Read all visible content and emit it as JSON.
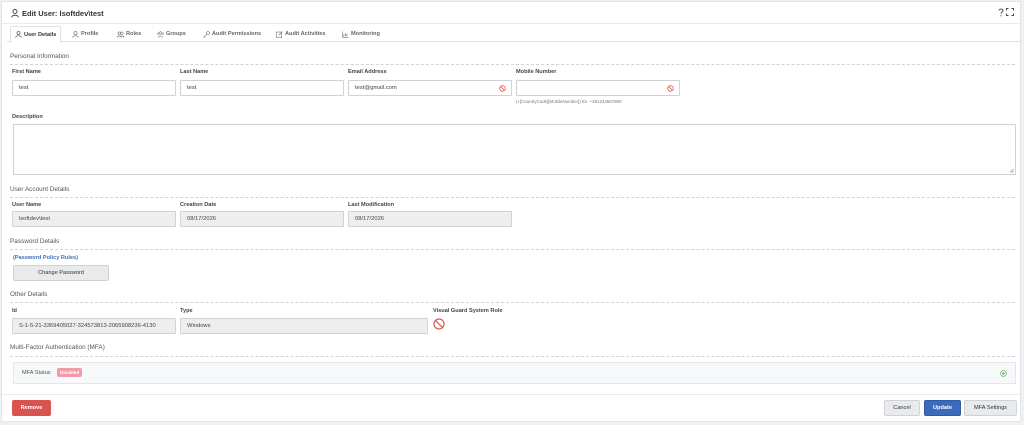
{
  "window": {
    "title": "Edit User: lsoftdev\\test"
  },
  "tabs": [
    {
      "label": "User Details",
      "icon": "user-icon",
      "active": true
    },
    {
      "label": "Profile",
      "icon": "user-icon"
    },
    {
      "label": "Roles",
      "icon": "users-icon"
    },
    {
      "label": "Groups",
      "icon": "groups-icon"
    },
    {
      "label": "Audit Permissions",
      "icon": "key-icon"
    },
    {
      "label": "Audit Activities",
      "icon": "edit-icon"
    },
    {
      "label": "Monitoring",
      "icon": "chart-icon"
    }
  ],
  "personal": {
    "section_title": "Personal Information",
    "first_name": {
      "label": "First Name",
      "value": "test"
    },
    "last_name": {
      "label": "Last Name",
      "value": "test"
    },
    "email": {
      "label": "Email Address",
      "value": "test@gmail.com"
    },
    "mobile": {
      "label": "Mobile Number",
      "value": "",
      "hint": "(+[CountryCode][MobileNumber]) Ex. +351234567890"
    },
    "description": {
      "label": "Description",
      "value": ""
    }
  },
  "account": {
    "section_title": "User Account Details",
    "user_name": {
      "label": "User Name",
      "value": "lsoftdev\\test"
    },
    "creation_date": {
      "label": "Creation Date",
      "value": "08/17/2026"
    },
    "last_modification": {
      "label": "Last Modification",
      "value": "08/17/2026"
    }
  },
  "password": {
    "section_title": "Password Details",
    "policy_link": "(Password Policy Rules)",
    "change_button": "Change Password"
  },
  "other": {
    "section_title": "Other Details",
    "id": {
      "label": "Id",
      "value": "S-1-5-21-3369405027-324573813-2065908236-4130"
    },
    "type": {
      "label": "Type",
      "value": "Windows"
    },
    "system_role": {
      "label": "Visual Guard System Role"
    }
  },
  "mfa": {
    "section_title": "Multi-Factor Authentication (MFA)",
    "status_label": "MFA Status",
    "status_badge": "Disabled"
  },
  "footer": {
    "remove": "Remove",
    "cancel": "Cancel",
    "update": "Update",
    "mfa_settings": "MFA Settings"
  },
  "colors": {
    "primary": "#3b6bbf",
    "danger": "#d9534f",
    "badge_disabled": "#f19aa7",
    "link": "#3f6fb5"
  }
}
